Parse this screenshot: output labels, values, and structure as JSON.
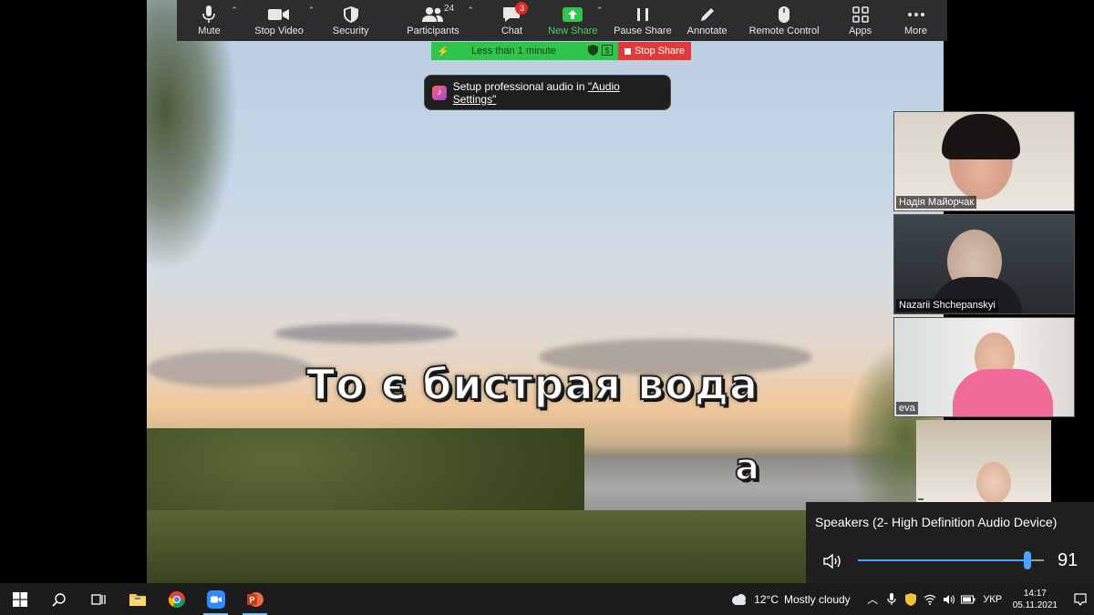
{
  "toolbar": {
    "mute": "Mute",
    "stop_video": "Stop Video",
    "security": "Security",
    "participants": "Participants",
    "participants_count": "24",
    "chat": "Chat",
    "chat_badge": "3",
    "new_share": "New Share",
    "pause_share": "Pause Share",
    "annotate": "Annotate",
    "remote_control": "Remote Control",
    "apps": "Apps",
    "more": "More"
  },
  "share_bar": {
    "timer_text": "Less than 1 minute",
    "stop_share": "Stop Share"
  },
  "tip": {
    "text": "Setup professional audio in ",
    "link": "\"Audio Settings\""
  },
  "shared_content": {
    "lyric_line": "То є бистрая вода",
    "lyric_next": "а"
  },
  "participants": [
    {
      "name": "Надія Майорчак"
    },
    {
      "name": "Nazarii Shchepanskyi"
    },
    {
      "name": "eva"
    },
    {
      "name": ""
    }
  ],
  "audio_flyout": {
    "device": "Speakers (2- High Definition Audio Device)",
    "volume": 91
  },
  "taskbar": {
    "weather_temp": "12°C",
    "weather_desc": "Mostly cloudy",
    "language": "УКР",
    "time": "14:17",
    "date": "05.11.2021"
  },
  "colors": {
    "toolbar_bg": "#2d2d2d",
    "share_green": "#2fc44a",
    "stop_red": "#e23a3a",
    "slider_blue": "#4aa3ff",
    "taskbar_bg": "#1c1c1c"
  }
}
